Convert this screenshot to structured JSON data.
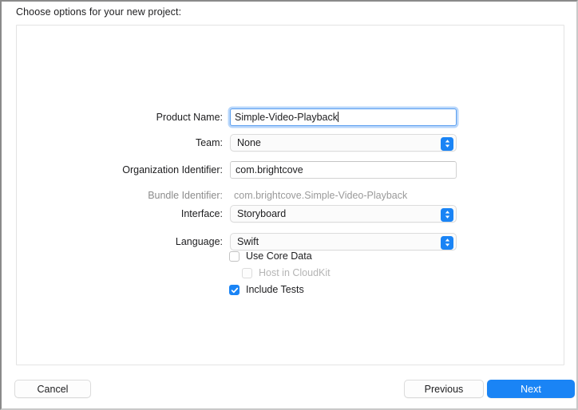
{
  "header": {
    "title": "Choose options for your new project:"
  },
  "form": {
    "fields": [
      {
        "label": "Product Name:",
        "type": "textfield-focused",
        "value": "Simple-Video-Playback"
      },
      {
        "label": "Team:",
        "type": "popup",
        "value": "None"
      },
      {
        "label": "Organization Identifier:",
        "type": "textfield",
        "value": "com.brightcove"
      },
      {
        "label": "Bundle Identifier:",
        "type": "static",
        "value": "com.brightcove.Simple-Video-Playback"
      },
      {
        "label": "Interface:",
        "type": "popup",
        "value": "Storyboard"
      },
      {
        "label": "Language:",
        "type": "popup",
        "value": "Swift"
      }
    ],
    "checkboxes": [
      {
        "label": "Use Core Data",
        "checked": false,
        "disabled": false
      },
      {
        "label": "Host in CloudKit",
        "checked": false,
        "disabled": true
      },
      {
        "label": "Include Tests",
        "checked": true,
        "disabled": false
      }
    ]
  },
  "footer": {
    "cancel_label": "Cancel",
    "previous_label": "Previous",
    "next_label": "Next"
  },
  "colors": {
    "accent": "#1a84f5",
    "focus_ring": "#5b9ff0",
    "text": "#1d1d1f",
    "muted_text": "#9a9a9a",
    "disabled_text": "#b5b5b5",
    "box_border": "#e3e3e3"
  },
  "icons": {
    "stepper": "chevron-up-down-icon",
    "checkmark": "checkmark-icon"
  }
}
